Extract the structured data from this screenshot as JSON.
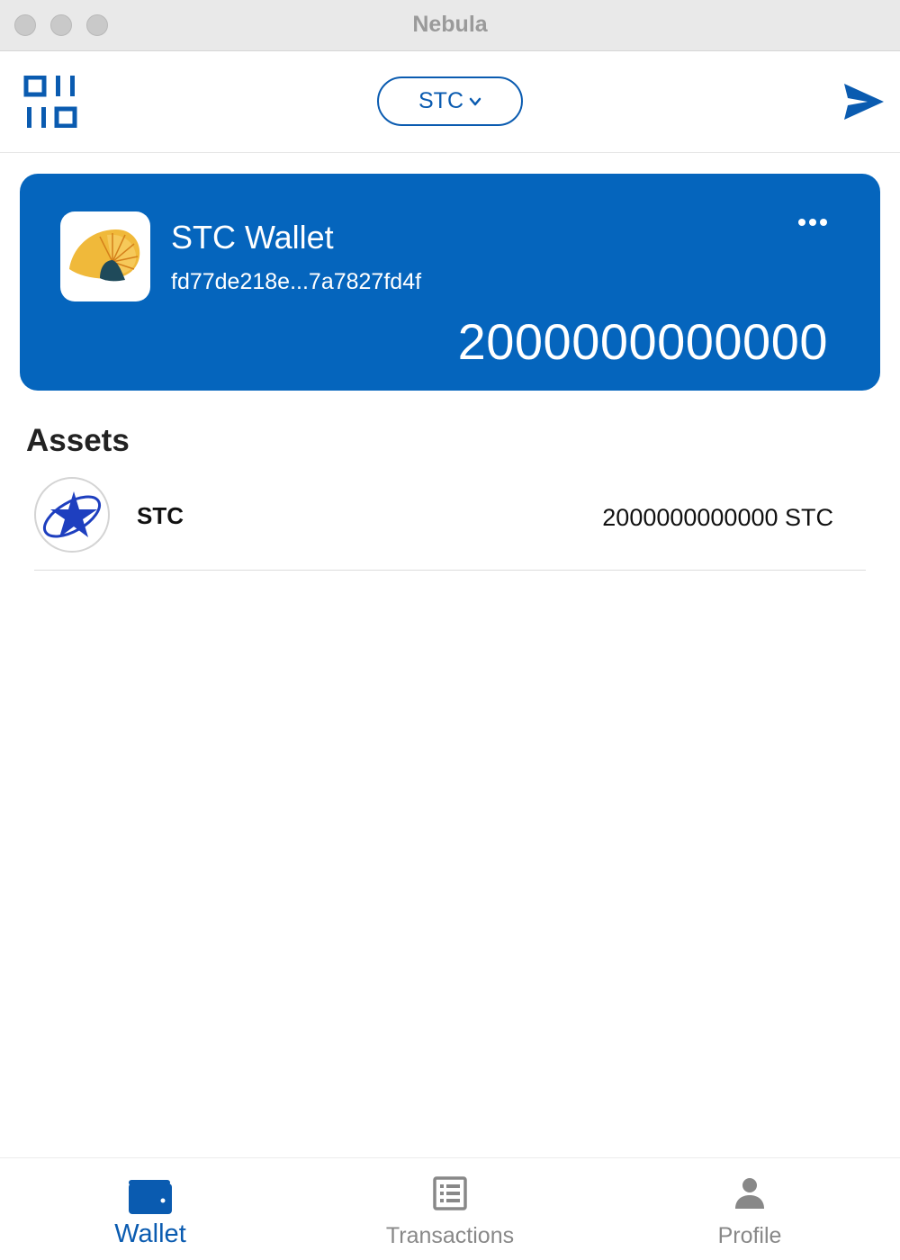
{
  "window": {
    "title": "Nebula"
  },
  "toolbar": {
    "scan_icon": "qr-scan-icon",
    "token_selector": {
      "value": "STC",
      "icon": "chevron-down-icon"
    },
    "send_icon": "send-icon"
  },
  "wallet_card": {
    "name": "STC Wallet",
    "address": "fd77de218e...7a7827fd4f",
    "balance": "2000000000000",
    "more_icon": "more-horizontal-icon",
    "logo_icon": "nautilus-logo-icon",
    "background_color": "#0565bd"
  },
  "assets": {
    "title": "Assets",
    "items": [
      {
        "symbol": "STC",
        "amount": "2000000000000 STC",
        "icon": "starcoin-logo-icon"
      }
    ]
  },
  "tabbar": {
    "active_color": "#0a5bb0",
    "inactive_color": "#888888",
    "tabs": [
      {
        "label": "Wallet",
        "icon": "wallet-icon",
        "active": true
      },
      {
        "label": "Transactions",
        "icon": "list-icon",
        "active": false
      },
      {
        "label": "Profile",
        "icon": "person-icon",
        "active": false
      }
    ]
  }
}
